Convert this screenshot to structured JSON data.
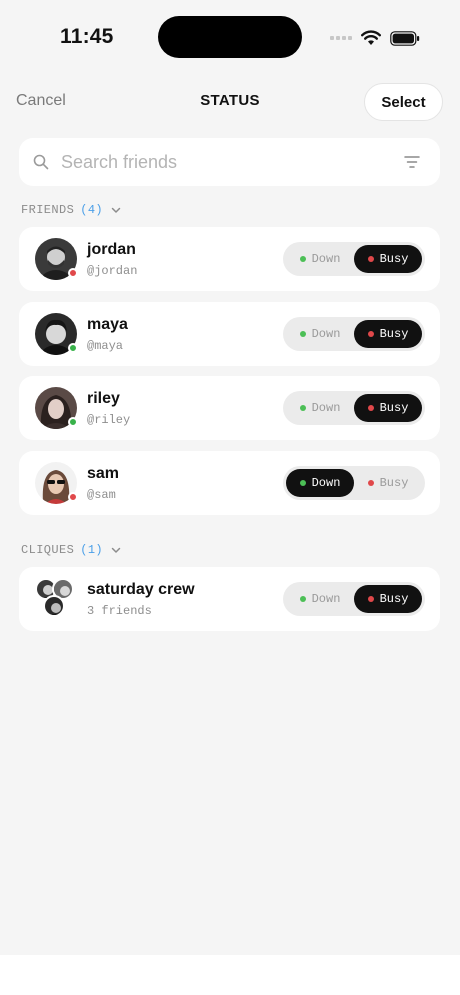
{
  "status_bar": {
    "time": "11:45"
  },
  "header": {
    "cancel": "Cancel",
    "title": "STATUS",
    "select": "Select"
  },
  "search": {
    "placeholder": "Search friends"
  },
  "friends_section": {
    "label": "FRIENDS",
    "count": "(4)"
  },
  "friends": [
    {
      "name": "jordan",
      "handle": "@jordan",
      "presence": "red",
      "down": "Down",
      "busy": "Busy",
      "selected": "busy"
    },
    {
      "name": "maya",
      "handle": "@maya",
      "presence": "green",
      "down": "Down",
      "busy": "Busy",
      "selected": "busy"
    },
    {
      "name": "riley",
      "handle": "@riley",
      "presence": "green",
      "down": "Down",
      "busy": "Busy",
      "selected": "busy"
    },
    {
      "name": "sam",
      "handle": "@sam",
      "presence": "red",
      "down": "Down",
      "busy": "Busy",
      "selected": "down"
    }
  ],
  "cliques_section": {
    "label": "CLIQUES",
    "count": "(1)"
  },
  "cliques": [
    {
      "name": "saturday crew",
      "subtitle": "3 friends",
      "down": "Down",
      "busy": "Busy",
      "selected": "busy"
    }
  ],
  "colors": {
    "accent_blue": "#4a9fe8",
    "busy_red": "#e0484a",
    "down_green": "#4cbf56",
    "active_segment": "#111111"
  }
}
